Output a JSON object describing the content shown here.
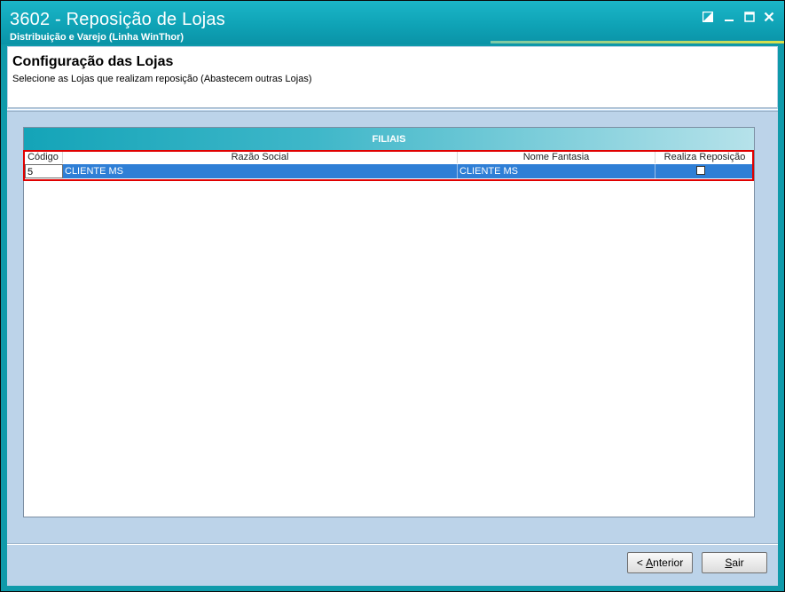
{
  "window": {
    "title": "3602 - Reposição de Lojas",
    "subtitle": "Distribuição e Varejo (Linha WinThor)",
    "controls": [
      "restore-icon",
      "minimize-icon",
      "maximize-icon",
      "close-icon"
    ]
  },
  "header": {
    "title": "Configuração das Lojas",
    "description": "Selecione as Lojas que realizam reposição (Abastecem outras Lojas)"
  },
  "panel": {
    "title": "FILIAIS",
    "columns": [
      "Código",
      "Razão Social",
      "Nome Fantasia",
      "Realiza Reposição"
    ],
    "rows": [
      {
        "codigo": "5",
        "razao_social": "CLIENTE MS",
        "nome_fantasia": "CLIENTE MS",
        "realiza_reposicao": false
      }
    ]
  },
  "buttons": {
    "anterior_prefix": "< ",
    "anterior_key": "A",
    "anterior_rest": "nterior",
    "sair_key": "S",
    "sair_rest": "air"
  },
  "colors": {
    "titlebar": "#0fa3b6",
    "selection": "#2f7fd6",
    "highlight": "#e00000",
    "background": "#bcd3e9"
  }
}
